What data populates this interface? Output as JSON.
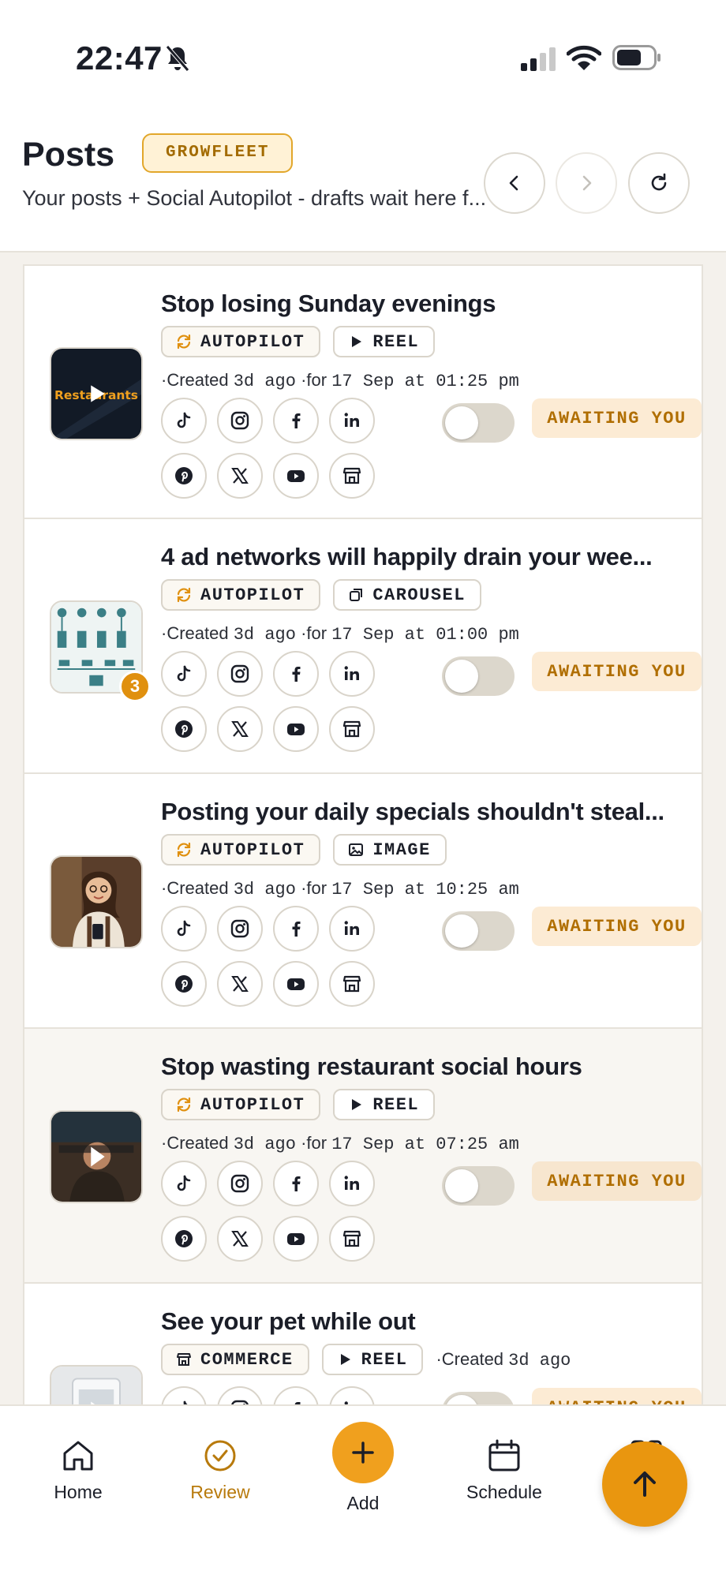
{
  "status_bar": {
    "time": "22:47"
  },
  "header": {
    "title": "Posts",
    "brand": "GROWFLEET",
    "subtitle": "Your posts + Social Autopilot - drafts wait here f..."
  },
  "posts": [
    {
      "title": "Stop losing Sunday evenings",
      "source": "AUTOPILOT",
      "format": "REEL",
      "created_label": "Created",
      "created": "3d ago",
      "for_label": "for",
      "scheduled": "17 Sep at 01:25 pm",
      "status": "AWAITING YOU",
      "thumb_text": "Restaurants"
    },
    {
      "title": "4 ad networks will happily drain your wee...",
      "source": "AUTOPILOT",
      "format": "CAROUSEL",
      "created_label": "Created",
      "created": "3d ago",
      "for_label": "for",
      "scheduled": "17 Sep at 01:00 pm",
      "status": "AWAITING YOU",
      "slide_count": "3"
    },
    {
      "title": "Posting your daily specials shouldn't steal...",
      "source": "AUTOPILOT",
      "format": "IMAGE",
      "created_label": "Created",
      "created": "3d ago",
      "for_label": "for",
      "scheduled": "17 Sep at 10:25 am",
      "status": "AWAITING YOU"
    },
    {
      "title": "Stop wasting restaurant social hours",
      "source": "AUTOPILOT",
      "format": "REEL",
      "created_label": "Created",
      "created": "3d ago",
      "for_label": "for",
      "scheduled": "17 Sep at 07:25 am",
      "status": "AWAITING YOU"
    },
    {
      "title": "See your pet while out",
      "source": "COMMERCE",
      "format": "REEL",
      "created_label": "Created",
      "created": "3d ago",
      "status": "AWAITING YOU"
    }
  ],
  "bottom_nav": {
    "home": "Home",
    "review": "Review",
    "add": "Add",
    "schedule": "Schedule"
  },
  "colors": {
    "accent": "#f0a01e",
    "status_text": "#b06e00",
    "status_bg": "#fcebd4"
  }
}
